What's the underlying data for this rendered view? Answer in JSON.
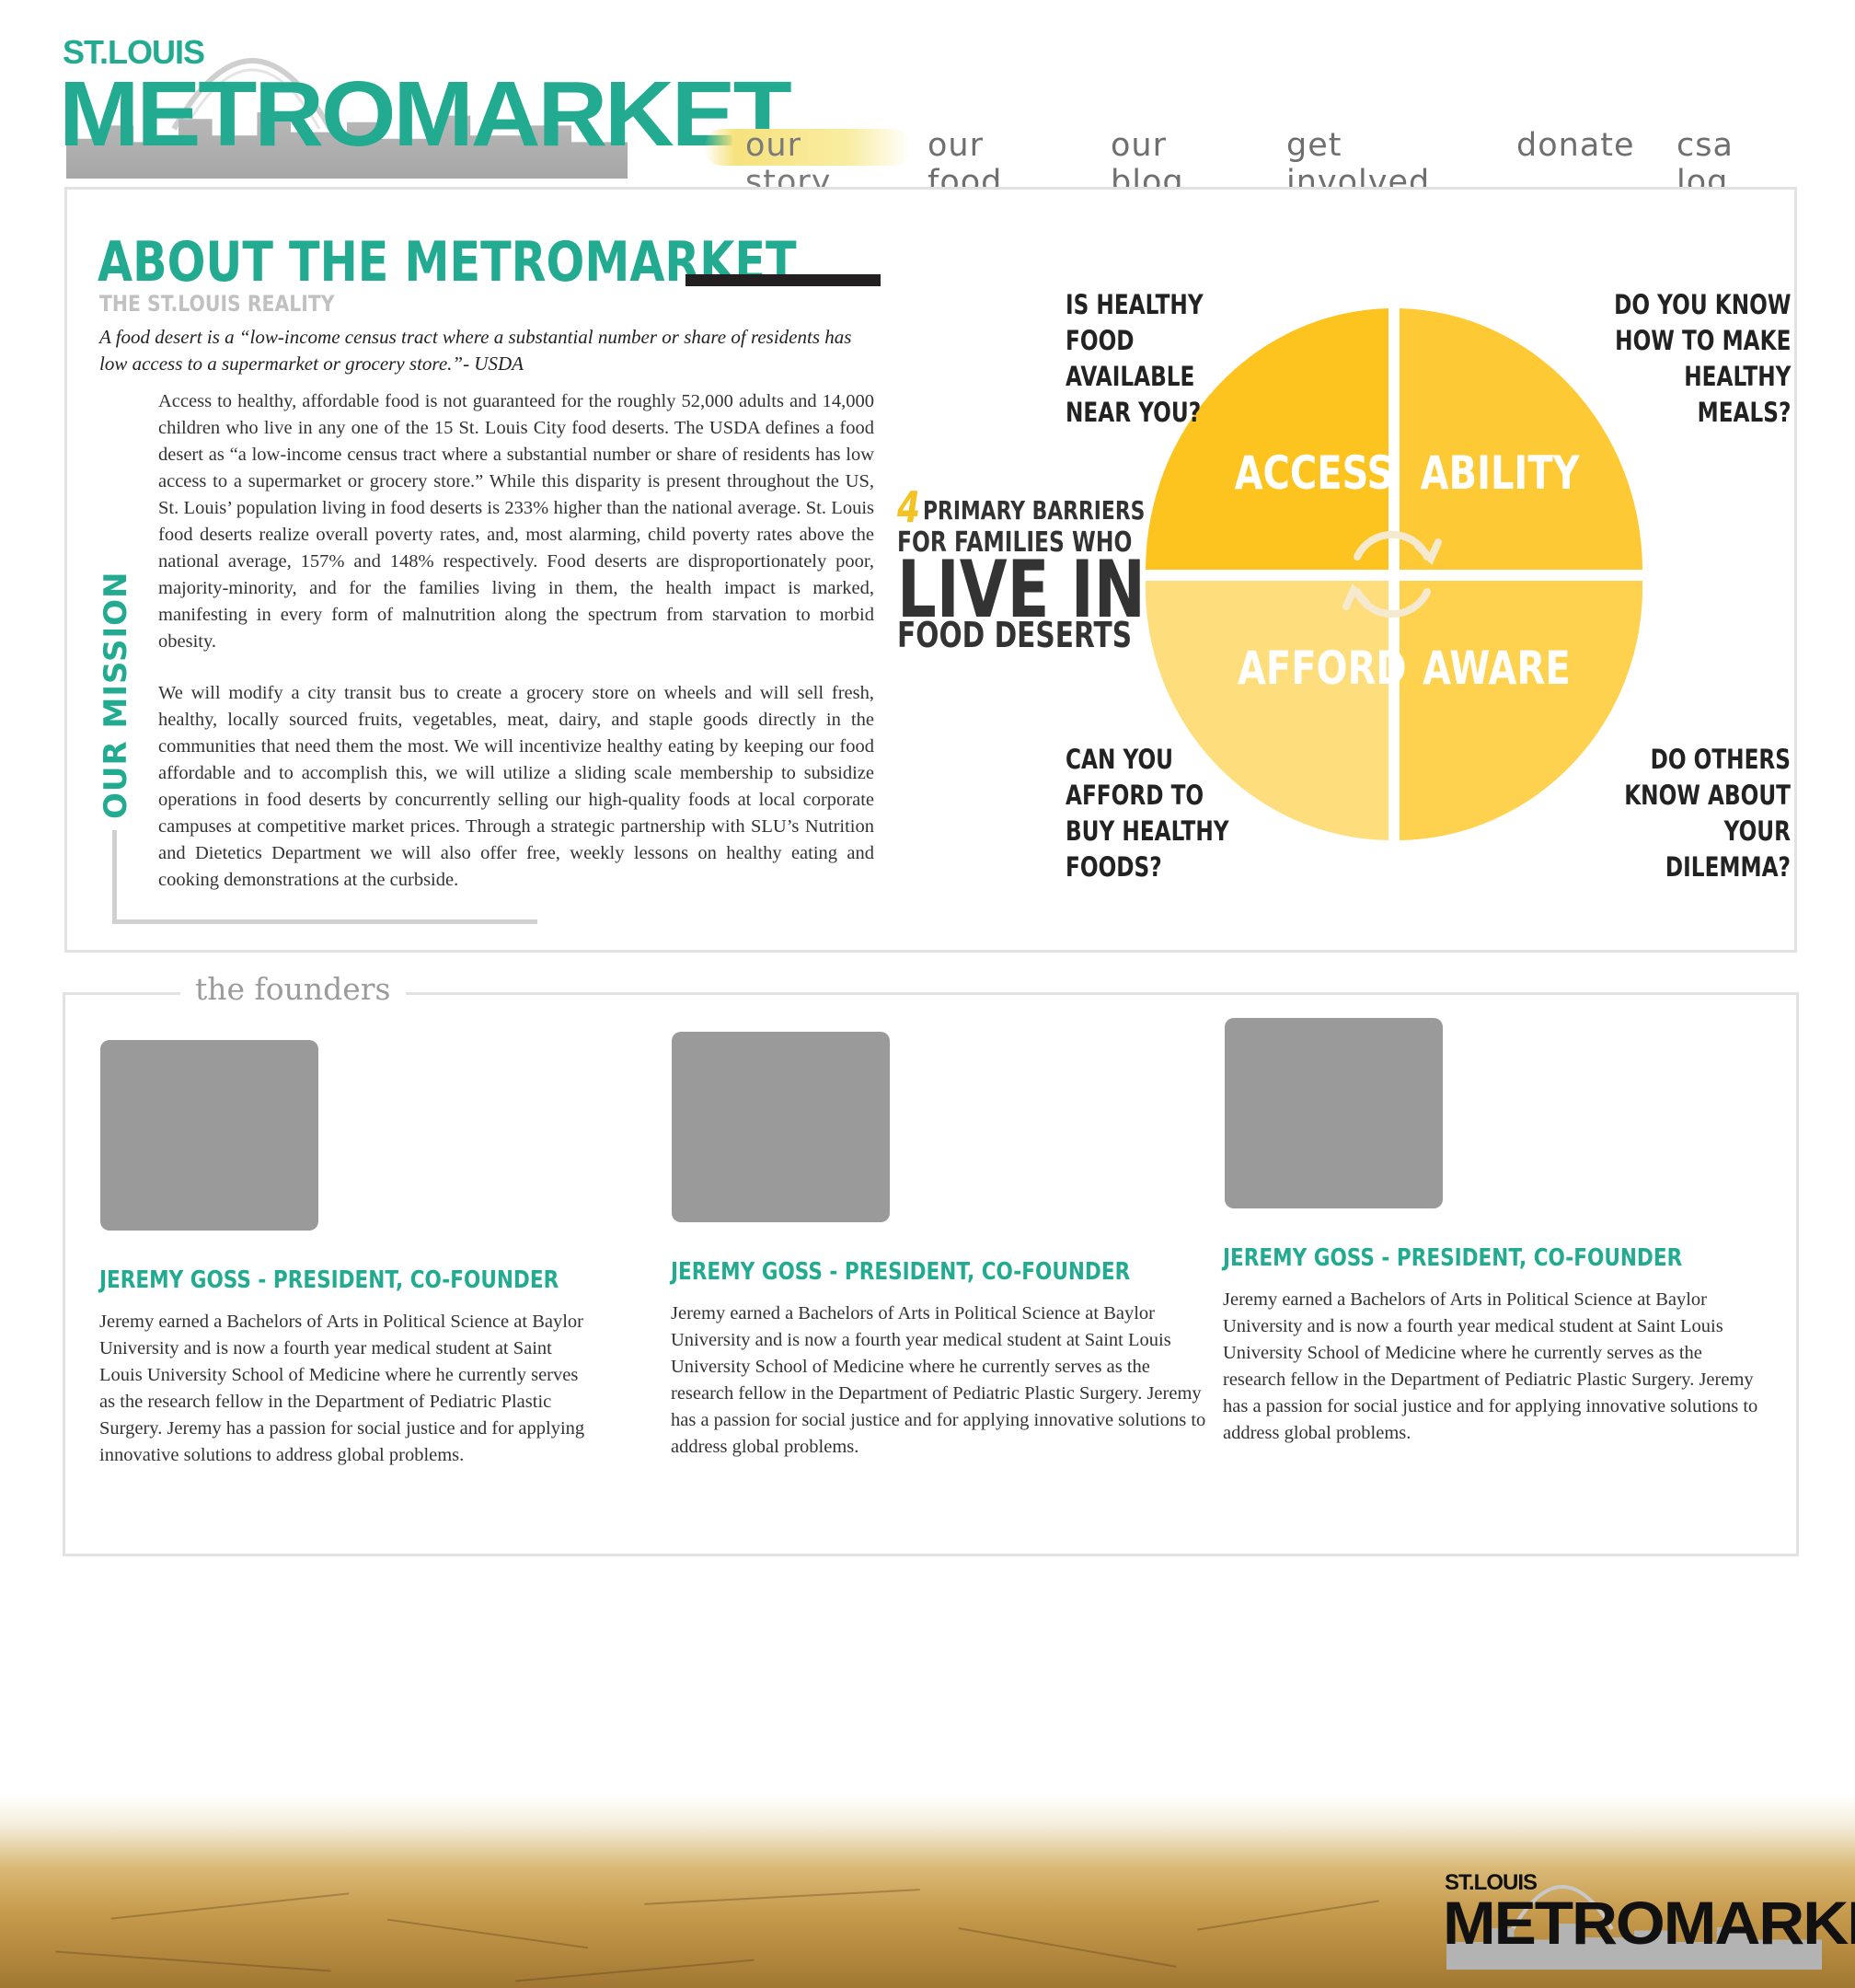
{
  "brand": {
    "small": "ST.LOUIS",
    "big": "METROMARKET",
    "accent": "#22ab90"
  },
  "nav": {
    "items": [
      {
        "label": "our story",
        "active": true
      },
      {
        "label": "our food"
      },
      {
        "label": "our blog"
      },
      {
        "label": "get involved"
      },
      {
        "label": "donate"
      },
      {
        "label": "csa log in"
      }
    ],
    "highlight_color": "#f6e27d"
  },
  "about": {
    "title": "ABOUT THE METROMARKET",
    "subtitle": "THE ST.LOUIS REALITY",
    "quote": "A food desert is a “low-income census tract where a substantial number or share of residents has low access to a supermarket or grocery store.”- USDA",
    "paragraph1": "Access to healthy, affordable food is not guaranteed for the roughly 52,000 adults and 14,000 children who live in any one of the 15 St. Louis City food deserts. The USDA defines a food desert as “a low-income census tract where a substantial number or share of residents has low access to a supermarket or grocery store.” While this disparity is present throughout the US, St. Louis’ population living in food deserts is 233% higher than the national average. St. Louis food deserts realize overall poverty rates, and, most alarming, child poverty rates above the national average, 157% and 148% respectively. Food deserts are disproportionately poor, majority-minority, and for the families living in them, the health impact is marked, manifesting in every form of malnutrition along the spectrum from starvation to morbid obesity.",
    "mission_label": "OUR MISSION",
    "paragraph2": "We will modify a city transit bus to create a grocery store on wheels and will sell fresh, healthy, locally sourced fruits, vegetables, meat, dairy, and staple goods directly in the communities that need them the most. We will incentivize healthy eating by keeping our food affordable and to accomplish this, we will utilize a sliding scale membership to subsidize operations in food deserts by concurrently selling our high-quality foods at local corporate campuses at competitive market prices. Through a strategic partnership with SLU’s Nutrition and Dietetics Department we will also offer free, weekly lessons on healthy eating and cooking demonstrations at the curbside."
  },
  "barriers": {
    "number": "4",
    "line1": "PRIMARY BARRIERS",
    "line2": "FOR FAMILIES WHO",
    "line3": "LIVE IN",
    "line4": "FOOD DESERTS",
    "quadrants": [
      {
        "label": "ACCESS",
        "color": "#fdc41f",
        "question": [
          "IS HEALTHY",
          "FOOD",
          "AVAILABLE",
          "NEAR YOU?"
        ]
      },
      {
        "label": "ABILITY",
        "color": "#fdc935",
        "question": [
          "DO YOU KNOW",
          "HOW TO MAKE",
          "HEALTHY",
          "MEALS?"
        ]
      },
      {
        "label": "AFFORD",
        "color": "#fedd7c",
        "question": [
          "CAN YOU",
          "AFFORD TO",
          "BUY HEALTHY",
          "FOODS?"
        ]
      },
      {
        "label": "AWARE",
        "color": "#fed14f",
        "question": [
          "DO OTHERS",
          "KNOW ABOUT",
          "YOUR",
          "DILEMMA?"
        ]
      }
    ]
  },
  "founders": {
    "legend": "the founders",
    "people": [
      {
        "name": "JEREMY GOSS - PRESIDENT, CO-FOUNDER",
        "bio": "Jeremy earned a Bachelors of Arts in Political Science at Baylor University and is now a fourth year medical student at Saint Louis University School of Medicine where he currently serves as the research fellow in the Department of Pediatric Plastic Surgery. Jeremy has a passion for social justice and for applying innovative solutions to address global problems."
      },
      {
        "name": "JEREMY GOSS - PRESIDENT, CO-FOUNDER",
        "bio": "Jeremy earned a Bachelors of Arts in Political Science at Baylor University and is now a fourth year medical student at Saint Louis University School of Medicine where he currently serves as the research fellow in the Department of Pediatric Plastic Surgery. Jeremy has a passion for social justice and for applying innovative solutions to address global problems."
      },
      {
        "name": "JEREMY GOSS - PRESIDENT, CO-FOUNDER",
        "bio": "Jeremy earned a Bachelors of Arts in Political Science at Baylor University and is now a fourth year medical student at Saint Louis University School of Medicine where he currently serves as the research fellow in the Department of Pediatric Plastic Surgery. Jeremy has a passion for social justice and for applying innovative solutions to address global problems."
      }
    ]
  },
  "footer": {
    "small": "ST.LOUIS",
    "big": "METROMARKET"
  }
}
